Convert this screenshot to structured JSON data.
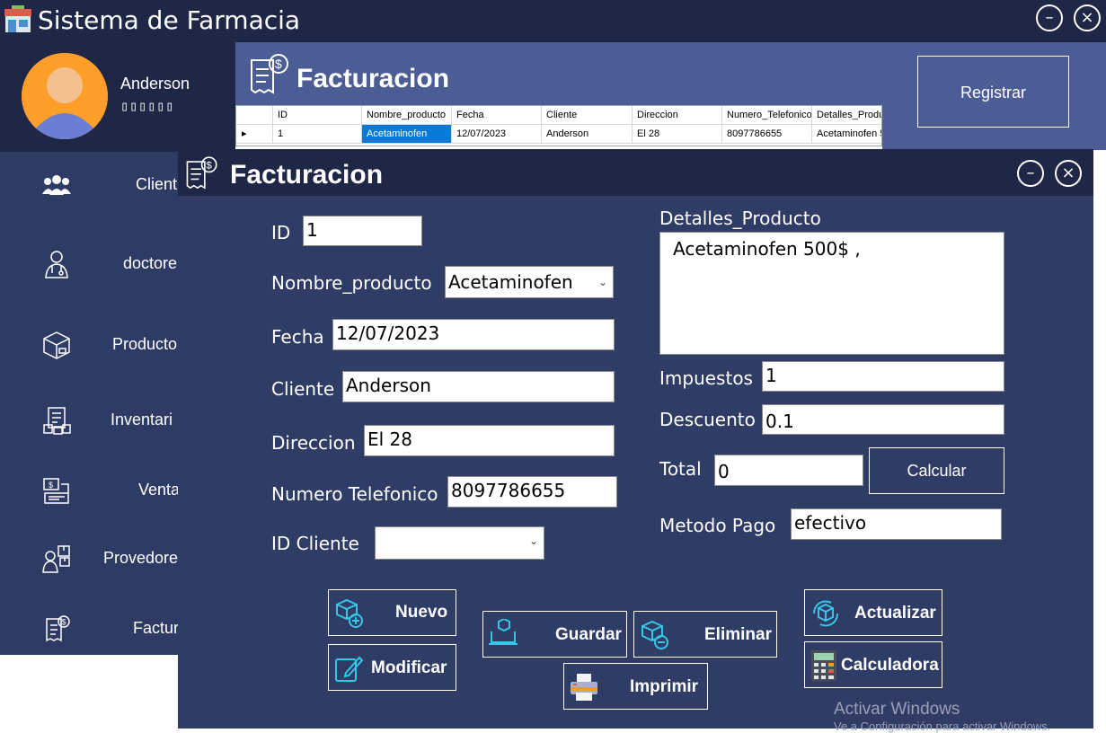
{
  "app": {
    "title": "Sistema de Farmacia"
  },
  "user": {
    "name": "Anderson",
    "role": "▯▯▯▯▯▯"
  },
  "sidebar": {
    "items": [
      {
        "label": "Client",
        "icon": "users-icon"
      },
      {
        "label": "doctore",
        "icon": "doctor-icon"
      },
      {
        "label": "Producto",
        "icon": "box-icon"
      },
      {
        "label": "Inventari",
        "icon": "inventory-icon"
      },
      {
        "label": "Venta",
        "icon": "sales-icon"
      },
      {
        "label": "Provedore",
        "icon": "supplier-icon"
      },
      {
        "label": "Factur",
        "icon": "invoice-icon"
      }
    ]
  },
  "header": {
    "title": "Facturacion",
    "register_label": "Registrar"
  },
  "grid": {
    "columns": [
      "ID",
      "Nombre_producto",
      "Fecha",
      "Cliente",
      "Direccion",
      "Numero_Telefonico",
      "Detalles_Produ"
    ],
    "rows": [
      [
        "1",
        "Acetaminofen",
        "12/07/2023",
        "Anderson",
        "El 28",
        "8097786655",
        "Acetaminofen 5"
      ]
    ]
  },
  "dialog": {
    "title": "Facturacion",
    "form": {
      "id_label": "ID",
      "id_value": "1",
      "nombre_label": "Nombre_producto",
      "nombre_value": "Acetaminofen",
      "fecha_label": "Fecha",
      "fecha_value": "12/07/2023",
      "cliente_label": "Cliente",
      "cliente_value": "Anderson",
      "direccion_label": "Direccion",
      "direccion_value": "El 28",
      "telefono_label": "Numero Telefonico",
      "telefono_value": "8097786655",
      "id_cliente_label": "ID Cliente",
      "id_cliente_value": "",
      "detalles_label": "Detalles_Producto",
      "detalles_value": "Acetaminofen 500$ ,",
      "impuestos_label": "Impuestos",
      "impuestos_value": "1",
      "descuento_label": "Descuento",
      "descuento_value": "0.1",
      "total_label": "Total",
      "total_value": "0",
      "metodo_label": "Metodo Pago",
      "metodo_value": "efectivo"
    },
    "buttons": {
      "calcular": "Calcular",
      "nuevo": "Nuevo",
      "modificar": "Modificar",
      "guardar": "Guardar",
      "eliminar": "Eliminar",
      "imprimir": "Imprimir",
      "actualizar": "Actualizar",
      "calculadora": "Calculadora"
    }
  },
  "watermark": {
    "line1": "Activar Windows",
    "line2": "Ve a Configuración para activar Windows."
  },
  "colors": {
    "titlebar": "#1f2746",
    "sidebar": "#2e3b64",
    "header": "#4b5d94",
    "dialog": "#2f3c66",
    "accent_cyan": "#35c7e8",
    "selection": "#0a7ad8"
  }
}
